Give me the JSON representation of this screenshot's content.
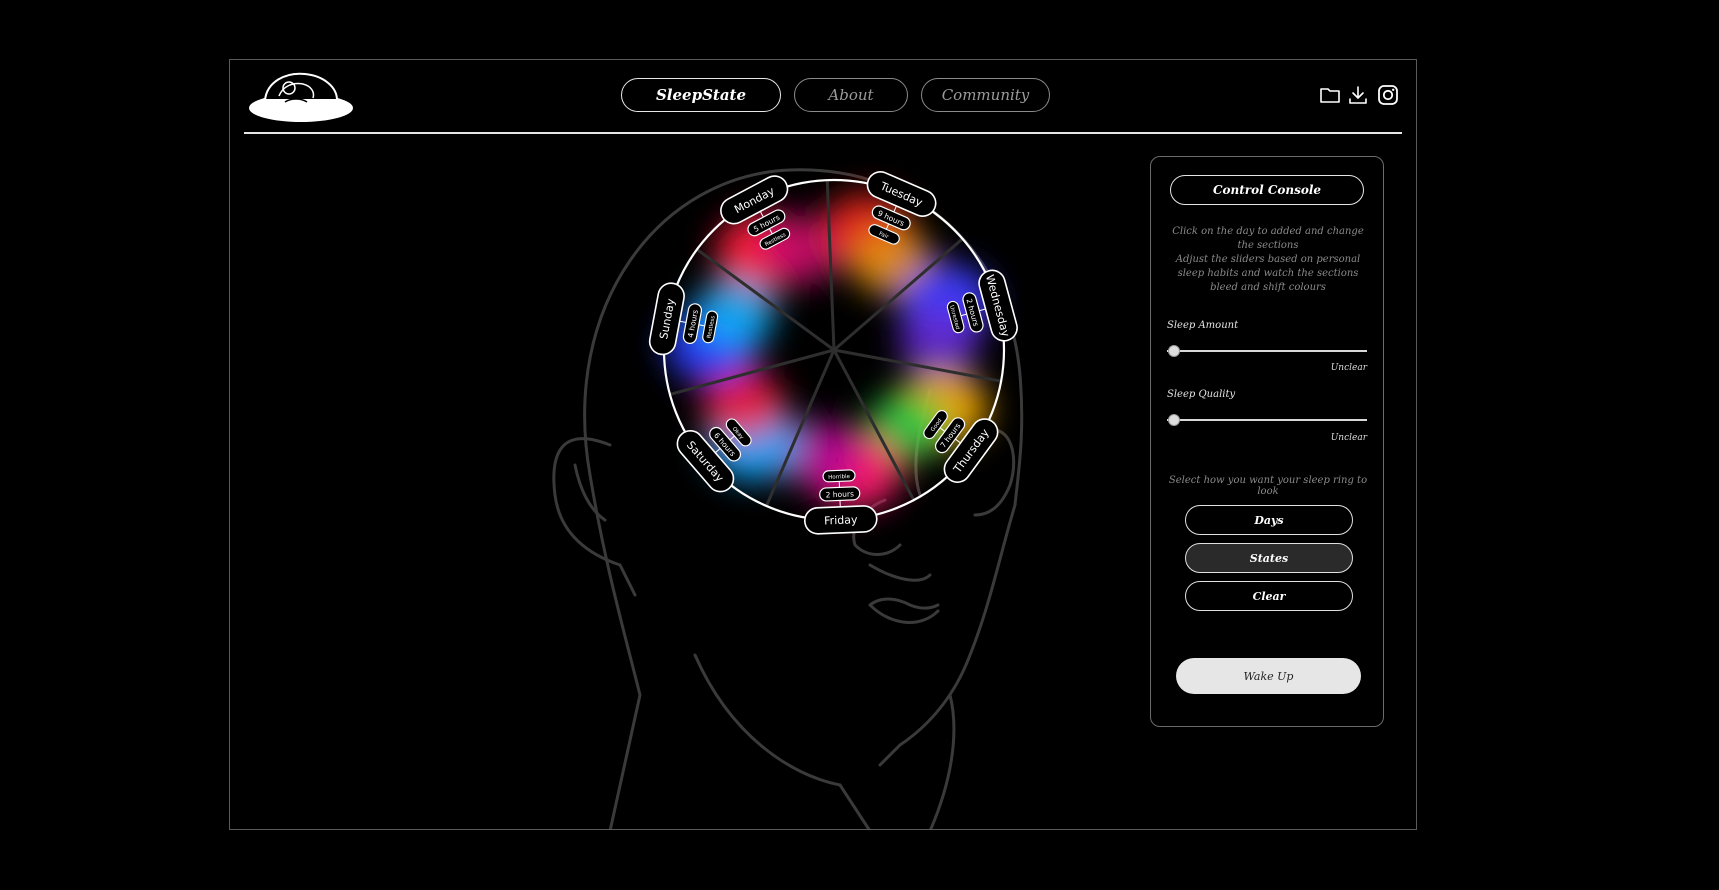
{
  "brand": {
    "logo_icon": "sleeping-person-logo"
  },
  "nav": [
    {
      "label": "SleepState",
      "active": true
    },
    {
      "label": "About",
      "active": false
    },
    {
      "label": "Community",
      "active": false
    }
  ],
  "top_icons": [
    "folder-icon",
    "download-icon",
    "instagram-icon"
  ],
  "wheel": {
    "days": [
      {
        "name": "Monday",
        "hours": "5 hours",
        "quality": "Restless",
        "colors": [
          "#ff1a3c",
          "#c21070"
        ]
      },
      {
        "name": "Tuesday",
        "hours": "9 hours",
        "quality": "Fair",
        "colors": [
          "#e8211f",
          "#e89a10"
        ]
      },
      {
        "name": "Wednesday",
        "hours": "2 hours",
        "quality": "Unrested",
        "colors": [
          "#3b3bff",
          "#6a2cd8"
        ]
      },
      {
        "name": "Thursday",
        "hours": "7 hours",
        "quality": "Good",
        "colors": [
          "#f0a800",
          "#19d04a"
        ]
      },
      {
        "name": "Friday",
        "hours": "2 hours",
        "quality": "Horrible",
        "colors": [
          "#ff1b6b",
          "#b0009a"
        ]
      },
      {
        "name": "Saturday",
        "hours": "6 hours",
        "quality": "Okay",
        "colors": [
          "#16a8ff",
          "#ff1a3c"
        ]
      },
      {
        "name": "Sunday",
        "hours": "4 hours",
        "quality": "Restless",
        "colors": [
          "#2c3cff",
          "#14b8ff"
        ]
      }
    ]
  },
  "console": {
    "title": "Control Console",
    "hint_line1": "Click on the day to added and change the sections",
    "hint_line2": "Adjust the sliders based on personal sleep habits and watch the sections bleed and shift colours",
    "sleep_amount_label": "Sleep Amount",
    "sleep_amount_value": "Unclear",
    "sleep_amount_level": 0,
    "sleep_quality_label": "Sleep Quality",
    "sleep_quality_value": "Unclear",
    "sleep_quality_level": 0,
    "select_hint": "Select how you want your sleep ring to look",
    "buttons": [
      {
        "label": "Days",
        "selected": false
      },
      {
        "label": "States",
        "selected": true
      },
      {
        "label": "Clear",
        "selected": false
      }
    ],
    "wake_label": "Wake Up"
  }
}
